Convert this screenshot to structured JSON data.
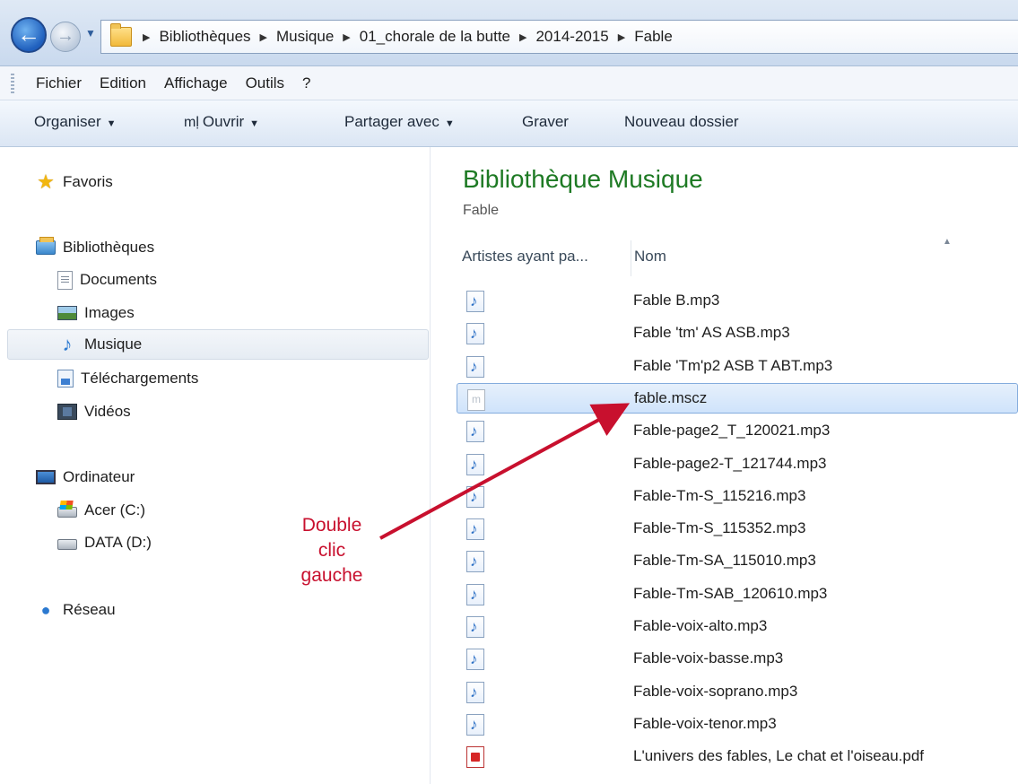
{
  "address": {
    "crumbs": [
      "Bibliothèques",
      "Musique",
      "01_chorale de la butte",
      "2014-2015",
      "Fable"
    ]
  },
  "menu": {
    "items": [
      "Fichier",
      "Edition",
      "Affichage",
      "Outils",
      "?"
    ]
  },
  "toolbar": {
    "organize": "Organiser",
    "open": "Ouvrir",
    "share": "Partager avec",
    "burn": "Graver",
    "new_folder": "Nouveau dossier"
  },
  "nav": {
    "favorites": "Favoris",
    "libraries": "Bibliothèques",
    "documents": "Documents",
    "images": "Images",
    "music": "Musique",
    "downloads": "Téléchargements",
    "videos": "Vidéos",
    "computer": "Ordinateur",
    "drive_c": "Acer (C:)",
    "drive_d": "DATA (D:)",
    "network": "Réseau"
  },
  "content": {
    "title": "Bibliothèque Musique",
    "subtitle": "Fable",
    "col_artists": "Artistes ayant pa...",
    "col_name": "Nom",
    "files": [
      {
        "name": "Fable B.mp3",
        "type": "music"
      },
      {
        "name": "Fable 'tm' AS ASB.mp3",
        "type": "music"
      },
      {
        "name": "Fable 'Tm'p2 ASB T ABT.mp3",
        "type": "music"
      },
      {
        "name": "fable.mscz",
        "type": "generic"
      },
      {
        "name": "Fable-page2_T_120021.mp3",
        "type": "music"
      },
      {
        "name": "Fable-page2-T_121744.mp3",
        "type": "music"
      },
      {
        "name": "Fable-Tm-S_115216.mp3",
        "type": "music"
      },
      {
        "name": "Fable-Tm-S_115352.mp3",
        "type": "music"
      },
      {
        "name": "Fable-Tm-SA_115010.mp3",
        "type": "music"
      },
      {
        "name": "Fable-Tm-SAB_120610.mp3",
        "type": "music"
      },
      {
        "name": "Fable-voix-alto.mp3",
        "type": "music"
      },
      {
        "name": "Fable-voix-basse.mp3",
        "type": "music"
      },
      {
        "name": "Fable-voix-soprano.mp3",
        "type": "music"
      },
      {
        "name": "Fable-voix-tenor.mp3",
        "type": "music"
      },
      {
        "name": "L'univers des fables, Le chat et l'oiseau.pdf",
        "type": "pdf"
      }
    ]
  },
  "annotation": {
    "line1": "Double",
    "line2": "clic",
    "line3": "gauche",
    "color": "#c8102e"
  }
}
